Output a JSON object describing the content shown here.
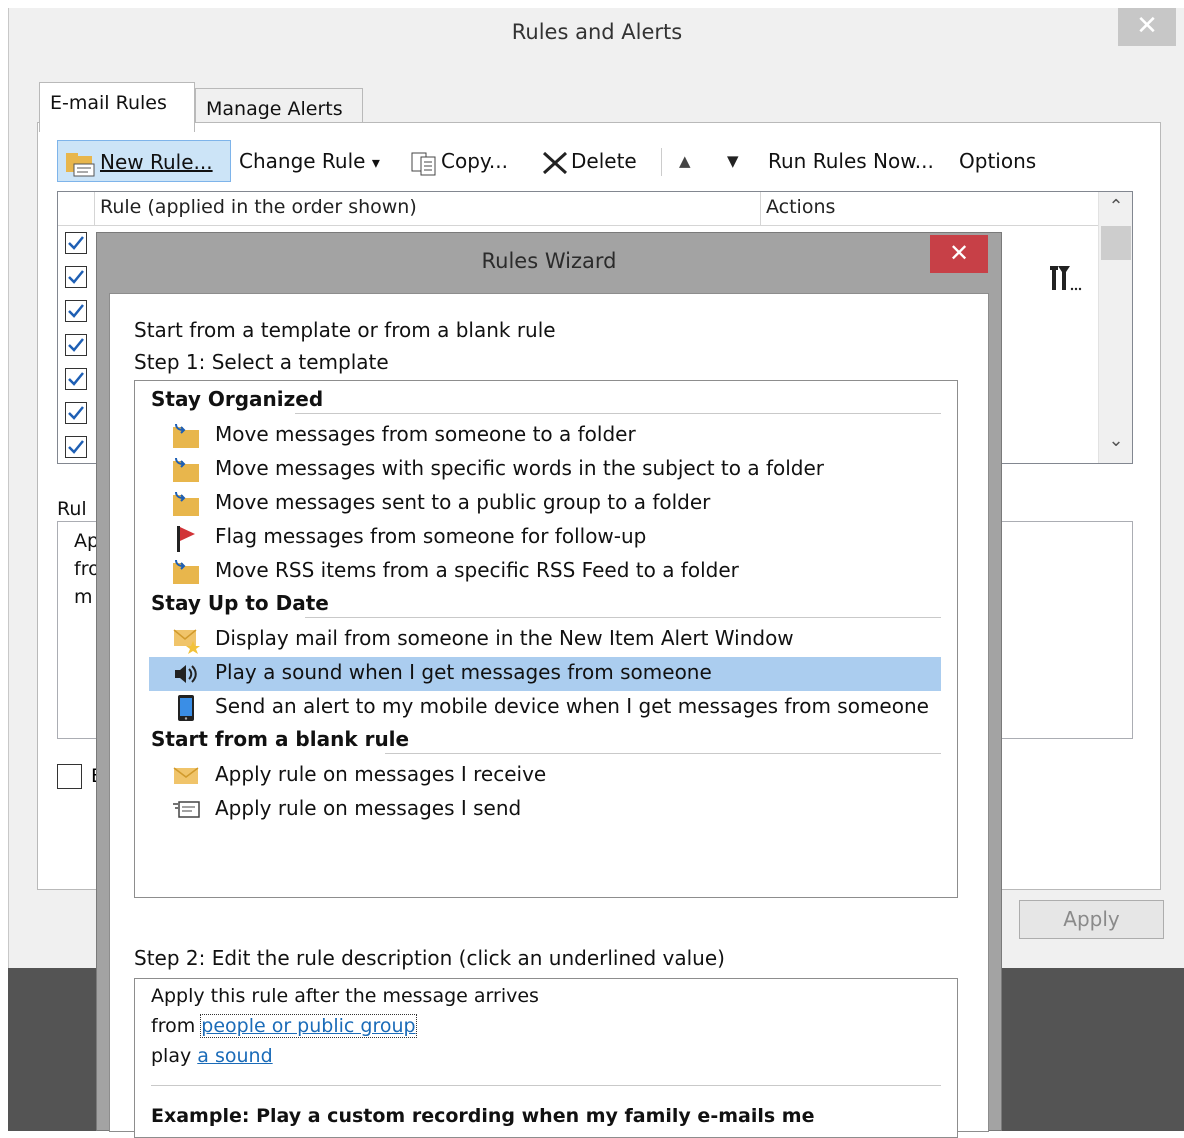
{
  "outer_dialog": {
    "title": "Rules and Alerts",
    "close_glyph": "✕",
    "tabs": [
      {
        "label": "E-mail Rules",
        "active": true
      },
      {
        "label": "Manage Alerts",
        "active": false
      }
    ],
    "toolbar": {
      "new_rule": "New Rule...",
      "change_rule": "Change Rule",
      "dropdown_glyph": "▾",
      "copy": "Copy...",
      "delete": "Delete",
      "up_glyph": "▲",
      "down_glyph": "▼",
      "run_rules_now": "Run Rules Now...",
      "options": "Options"
    },
    "rules_list": {
      "col_rule": "Rule (applied in the order shown)",
      "col_actions": "Actions",
      "rows_checked": [
        true,
        true,
        true,
        true,
        true,
        true,
        true
      ],
      "scroll_up_glyph": "⌃",
      "scroll_down_glyph": "⌄"
    },
    "rule_description_label": "Rul",
    "rule_description_partial": [
      "Ap",
      "fro",
      "m"
    ],
    "checkbox_label_partial": "E",
    "apply_button": "Apply"
  },
  "wizard": {
    "title": "Rules Wizard",
    "close_glyph": "✕",
    "intro": "Start from a template or from a blank rule",
    "step1": "Step 1: Select a template",
    "groups": [
      {
        "name": "Stay Organized",
        "items": [
          {
            "icon": "folder-move-icon",
            "label": "Move messages from someone to a folder"
          },
          {
            "icon": "folder-move-icon",
            "label": "Move messages with specific words in the subject to a folder"
          },
          {
            "icon": "folder-move-icon",
            "label": "Move messages sent to a public group to a folder"
          },
          {
            "icon": "red-flag-icon",
            "label": "Flag messages from someone for follow-up"
          },
          {
            "icon": "folder-move-icon",
            "label": "Move RSS items from a specific RSS Feed to a folder"
          }
        ]
      },
      {
        "name": "Stay Up to Date",
        "items": [
          {
            "icon": "mail-star-icon",
            "label": "Display mail from someone in the New Item Alert Window"
          },
          {
            "icon": "speaker-icon",
            "label": "Play a sound when I get messages from someone",
            "selected": true
          },
          {
            "icon": "mobile-device-icon",
            "label": "Send an alert to my mobile device when I get messages from someone"
          }
        ]
      },
      {
        "name": "Start from a blank rule",
        "items": [
          {
            "icon": "envelope-icon",
            "label": "Apply rule on messages I receive"
          },
          {
            "icon": "send-message-icon",
            "label": "Apply rule on messages I send"
          }
        ]
      }
    ],
    "step2": "Step 2: Edit the rule description (click an underlined value)",
    "description": {
      "line1": "Apply this rule after the message arrives",
      "line2_prefix": "from",
      "line2_link": "people or public group",
      "line3_prefix": "play",
      "line3_link": "a sound",
      "example": "Example: Play a custom recording when my family e-mails me"
    }
  },
  "colors": {
    "selection": "#abcdef",
    "link": "#1a6bb8",
    "close_red": "#c74047",
    "folder": "#e8b64c",
    "flag": "#d13438"
  }
}
